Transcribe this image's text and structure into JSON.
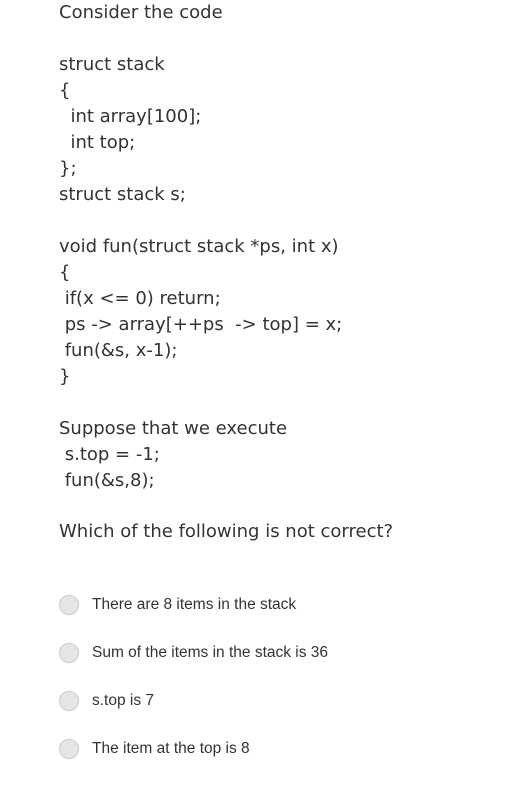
{
  "question": {
    "lines": [
      "Consider the code",
      "",
      "struct stack",
      "{",
      "  int array[100];",
      "  int top;",
      "};",
      "struct stack s;",
      "",
      "void fun(struct stack *ps, int x)",
      "{",
      " if(x <= 0) return;",
      " ps -> array[++ps  -> top] = x;",
      " fun(&s, x-1);",
      "}",
      "",
      "Suppose that we execute",
      " s.top = -1;",
      " fun(&s,8);"
    ],
    "prompt": "Which of the following is not correct?",
    "reader_icon": "immersive-reader-icon"
  },
  "options": [
    {
      "label": "There are 8 items in the stack",
      "selected": false
    },
    {
      "label": "Sum of the items in the stack is 36",
      "selected": false
    },
    {
      "label": "s.top is 7",
      "selected": false
    },
    {
      "label": "The item at the top is 8",
      "selected": false
    }
  ],
  "colors": {
    "text": "#333333",
    "radio_fill": "#e6e6e6",
    "radio_border": "#c9c9c9",
    "background": "#ffffff"
  }
}
